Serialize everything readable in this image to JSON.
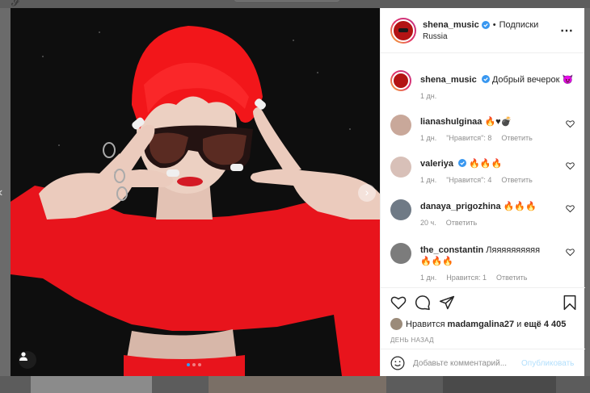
{
  "post": {
    "username": "shena_music",
    "follow_sep": "•",
    "follow_label": "Подписки",
    "location": "Russia",
    "caption": "Добрый вечерок 😈",
    "caption_time": "1 дн."
  },
  "comments": [
    {
      "username": "lianashulginaa",
      "text": "🔥♥💣",
      "time": "1 дн.",
      "likes": "\"Нравится\": 8",
      "reply": "Ответить",
      "avatar_color": "#c9a89a"
    },
    {
      "username": "valeriya",
      "verified": true,
      "text": "🔥🔥🔥",
      "time": "1 дн.",
      "likes": "\"Нравится\": 4",
      "reply": "Ответить",
      "avatar_color": "#d8c0b8"
    },
    {
      "username": "danaya_prigozhina",
      "text": "🔥🔥🔥",
      "time": "20 ч.",
      "reply": "Ответить",
      "avatar_color": "#6f7a86"
    },
    {
      "username": "the_constantin",
      "text": "Ляяяяяяяяяя🔥🔥🔥",
      "time": "1 дн.",
      "likes": "Нравится: 1",
      "reply": "Ответить",
      "avatar_color": "#7c7c7c"
    }
  ],
  "likes": {
    "prefix": "Нравится",
    "user": "madamgalina27",
    "and": "и",
    "count": "ещё 4 405"
  },
  "date_label": "ДЕНЬ НАЗАД",
  "add_comment": {
    "placeholder": "Добавьте комментарий...",
    "publish_label": "Опубликовать"
  },
  "carousel": {
    "count": 3,
    "active_index": 0
  },
  "colors": {
    "accent_blue": "#0095f6",
    "verified": "#3897f0"
  }
}
